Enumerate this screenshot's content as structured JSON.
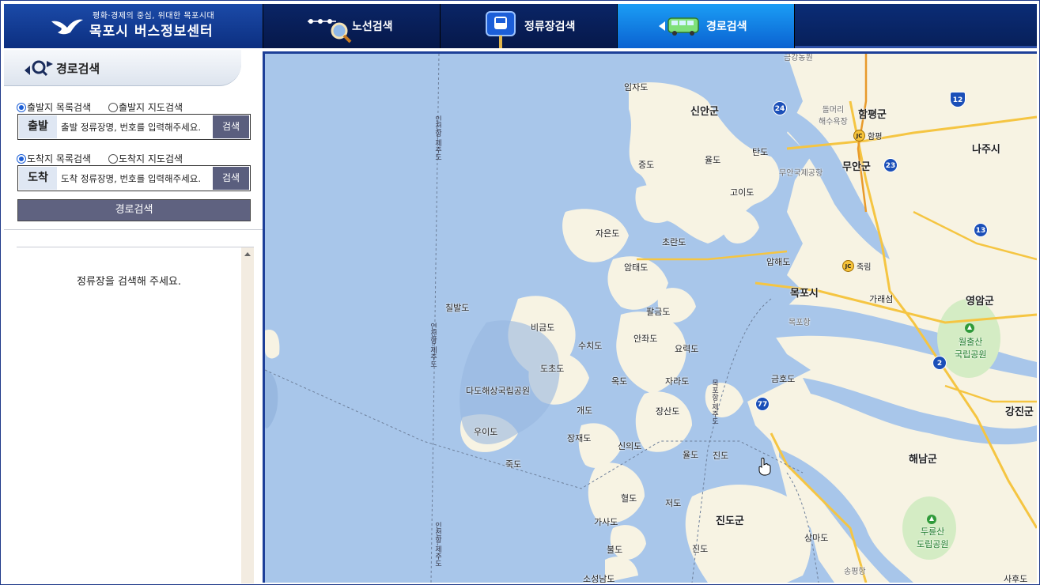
{
  "header": {
    "slogan": "평화·경제의 중심, 위대한 목포시대",
    "logo_title": "목포시 버스정보센터",
    "tabs": [
      {
        "label": "노선검색",
        "icon": "route-line-icon"
      },
      {
        "label": "정류장검색",
        "icon": "bus-stop-icon"
      },
      {
        "label": "경로검색",
        "icon": "bus-path-icon",
        "active": true
      }
    ]
  },
  "panel": {
    "title": "경로검색",
    "origin": {
      "radio_list": "출발지 목록검색",
      "radio_map": "출발지 지도검색",
      "tag": "출발",
      "placeholder": "출발 정류장명, 번호를 입력해주세요.",
      "button": "검색"
    },
    "destination": {
      "radio_list": "도착지 목록검색",
      "radio_map": "도착지 지도검색",
      "tag": "도착",
      "placeholder": "도착 정류장명, 번호를 입력해주세요.",
      "button": "검색"
    },
    "route_button": "경로검색",
    "results_message": "정류장을 검색해 주세요."
  },
  "map": {
    "labels": {
      "imjado": "임자도",
      "sinan": "신안군",
      "hampyeong": "함평군",
      "najusi": "나주시",
      "tando": "탄도",
      "jeungdo": "증도",
      "yuldo": "율도",
      "muan_airport": "무안국제공항",
      "muan": "무안군",
      "goido": "고이도",
      "jaeundo": "자은도",
      "chorando": "초란도",
      "amtaedo": "암태도",
      "aphaedo": "압해도",
      "mokposi": "목포시",
      "garaesom": "가래섬",
      "yeongam": "영암군",
      "chilbaldo": "칠발도",
      "palgeumdo": "팔금도",
      "mokpohang": "목포항",
      "bigeumdo": "비금도",
      "suchido": "수치도",
      "anjwado": "안좌도",
      "yoryeokdo": "요력도",
      "dochodo": "도초도",
      "okdo": "옥도",
      "jaradodo": "자라도",
      "geumhodo": "금호도",
      "dadahae": "다도해상국립공원",
      "gaedo": "개도",
      "jangsando": "장산도",
      "gangjin": "강진군",
      "uido": "우이도",
      "jangjaedo": "장재도",
      "sinuido": "신의도",
      "yuldo2": "율도",
      "jindo_island": "진도",
      "haenam": "해남군",
      "jukdo": "죽도",
      "hyeoldo": "혈도",
      "jeodo": "저도",
      "jindo_gun": "진도군",
      "sangmado": "상마도",
      "gasado": "가사도",
      "bulldo": "불도",
      "jindo2": "진도",
      "songpyeonghang": "송평항",
      "soseongnamdo": "소성남도",
      "sahudo": "사후도",
      "dolmeori": "돌머리\n해수욕장",
      "wolchulsan": "월출산\n국립공원",
      "dureunsan": "두륜산\n도립공원",
      "hampyeong_jc": "함평",
      "jungang_jc": "죽림",
      "route_vert1": "인천항-제주도",
      "route_vert2": "인천항-제주도",
      "route_vert3": "인천항-제주도",
      "route_vert4": "목포항-제주도",
      "top_clip": "금강농원"
    },
    "roads": [
      "24",
      "23",
      "12",
      "13",
      "2",
      "77"
    ],
    "colors": {
      "sea": "#a8c6ea",
      "land": "#f7f3e3",
      "road": "#f5c542",
      "highway": "#1b4fb8"
    }
  }
}
